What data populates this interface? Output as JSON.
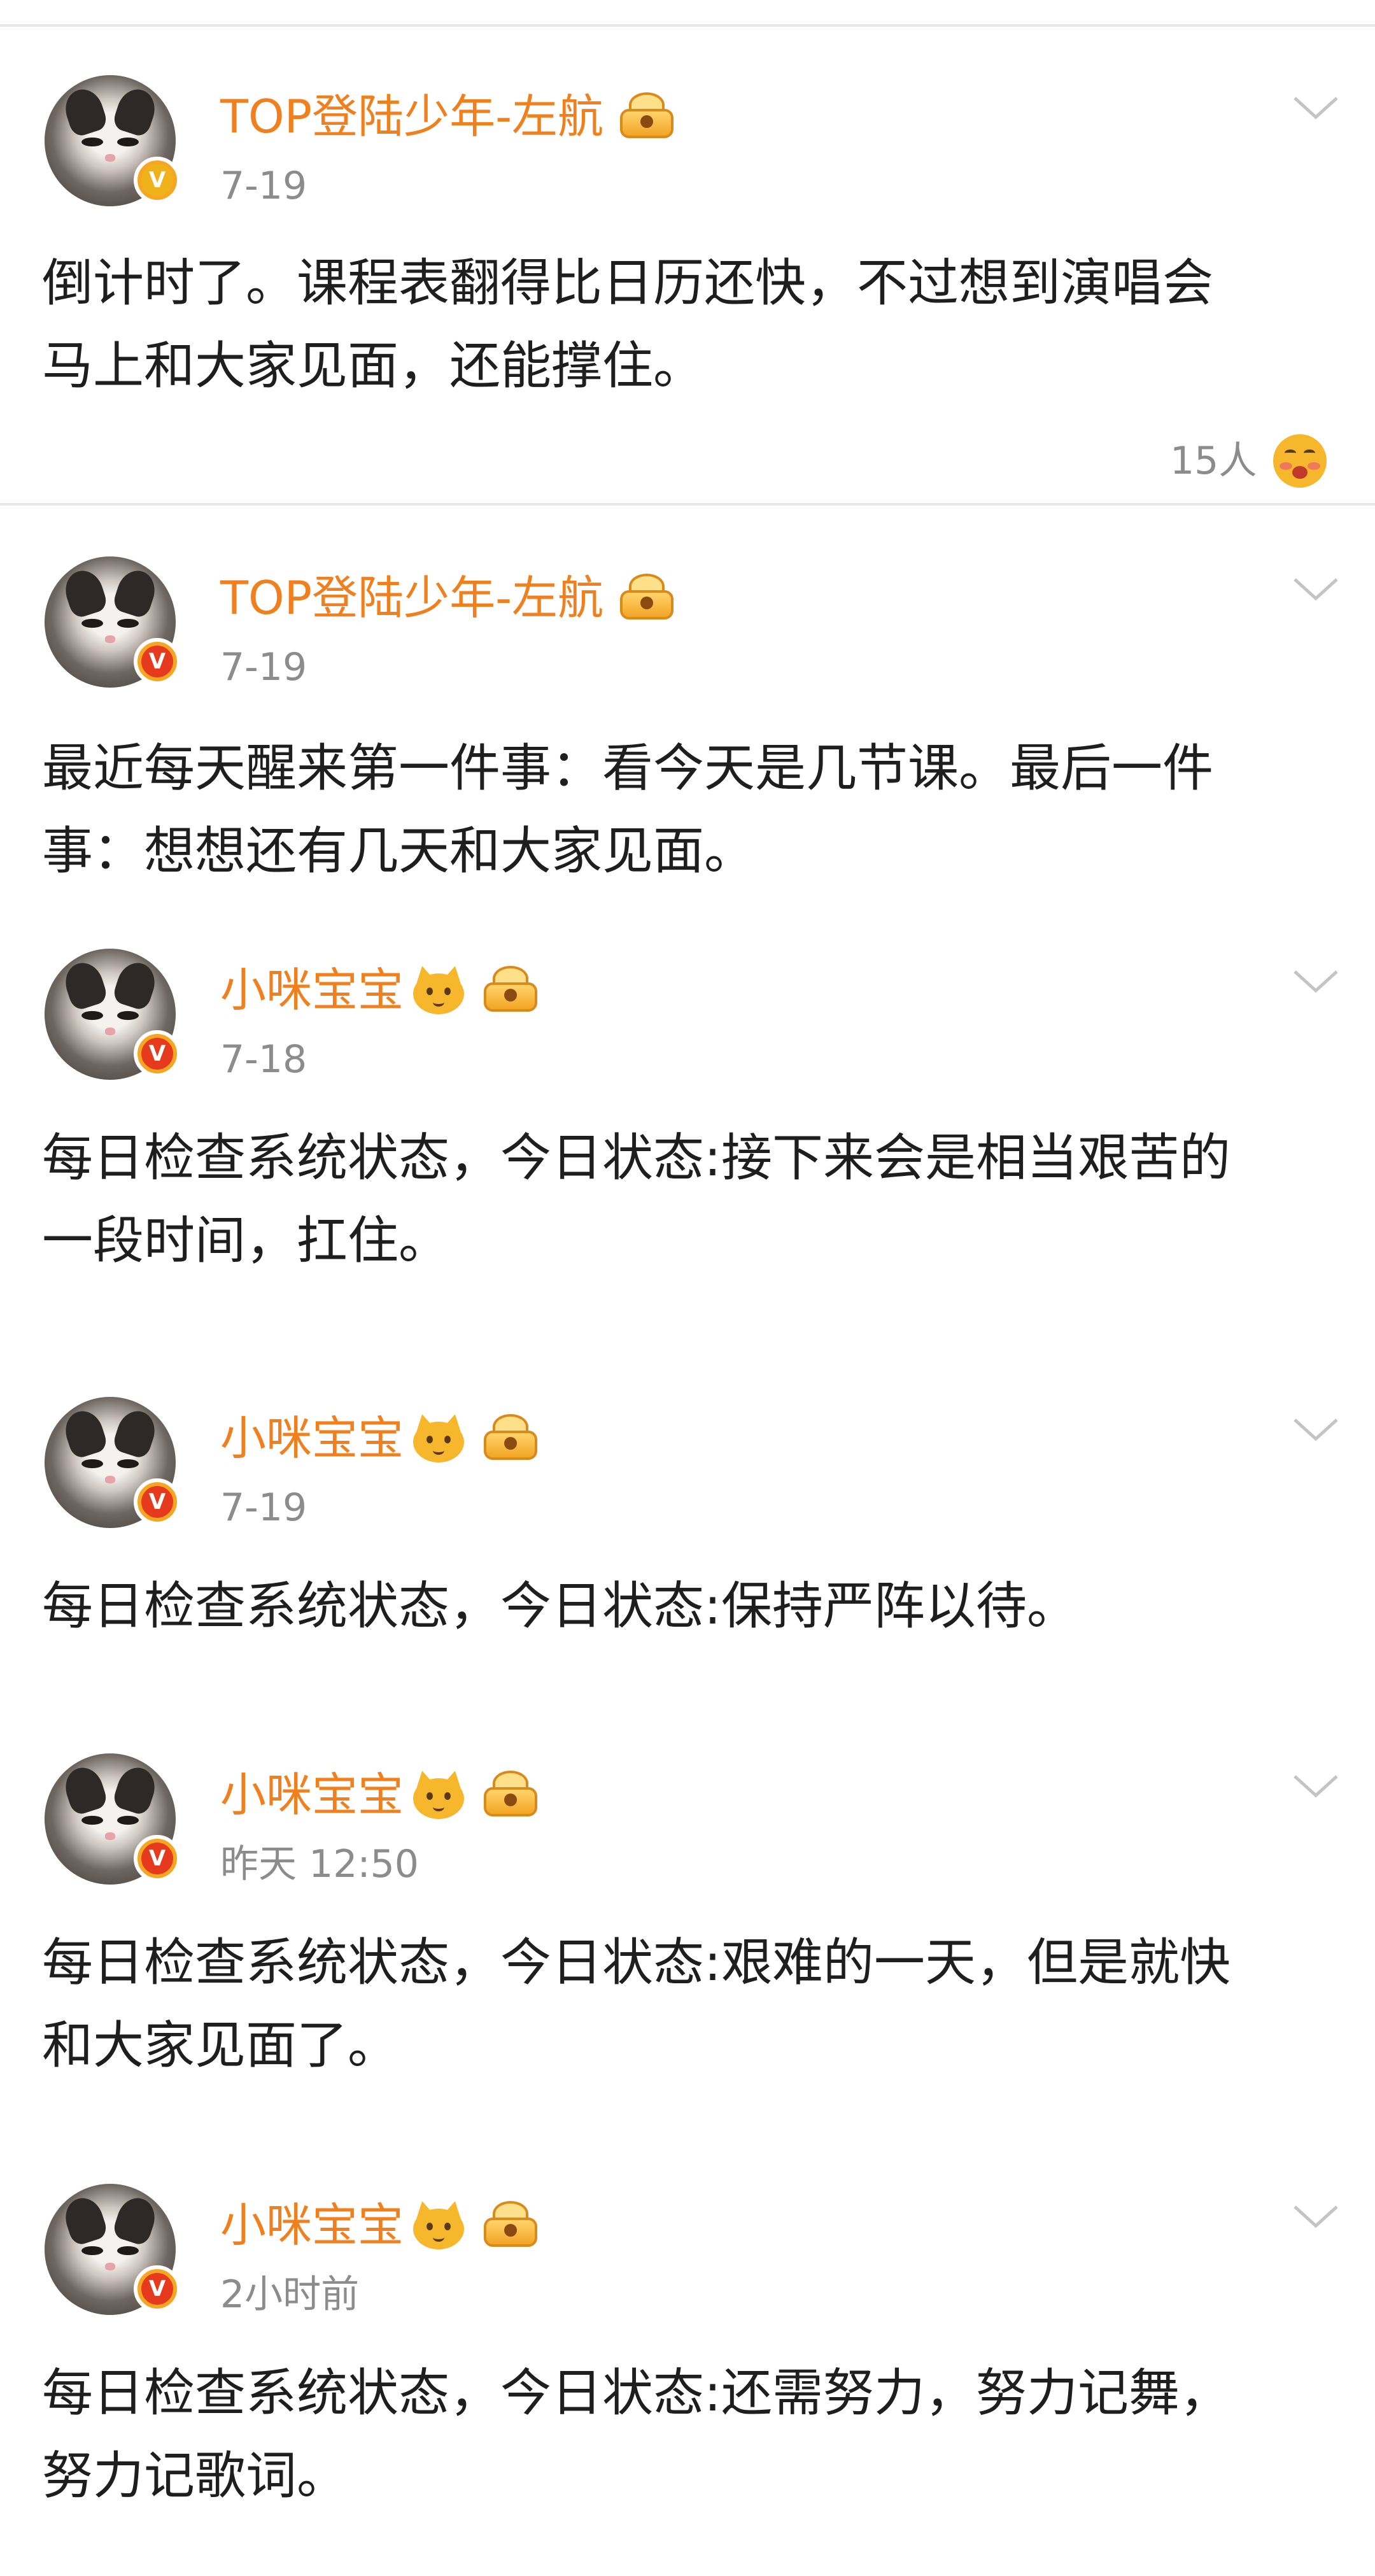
{
  "colors": {
    "name": "#f07f1e",
    "meta": "#8c8c8c",
    "text": "#1e1e1e",
    "divider": "#e7e7e7"
  },
  "posts": [
    {
      "author": "TOP登陆少年-左航",
      "date": "7-19",
      "content_lines": [
        "倒计时了。课程表翻得比日历还快，不过想到演唱会",
        "马上和大家见面，还能撑住。"
      ],
      "likes": "15人"
    },
    {
      "author": "TOP登陆少年-左航",
      "date": "7-19",
      "content_lines": [
        "最近每天醒来第一件事：看今天是几节课。最后一件",
        "事：想想还有几天和大家见面。"
      ]
    },
    {
      "author": "小咪宝宝",
      "date": "7-18",
      "content_lines": [
        "每日检查系统状态，今日状态:接下来会是相当艰苦的",
        "一段时间，扛住。"
      ]
    },
    {
      "author": "小咪宝宝",
      "date": "7-19",
      "content_lines": [
        "每日检查系统状态，今日状态:保持严阵以待。"
      ]
    },
    {
      "author": "小咪宝宝",
      "date": "昨天 12:50",
      "content_lines": [
        "每日检查系统状态，今日状态:艰难的一天，但是就快",
        "和大家见面了。"
      ]
    },
    {
      "author": "小咪宝宝",
      "date": "2小时前",
      "content_lines": [
        "每日检查系统状态，今日状态:还需努力，努力记舞，",
        "努力记歌词。"
      ]
    }
  ]
}
